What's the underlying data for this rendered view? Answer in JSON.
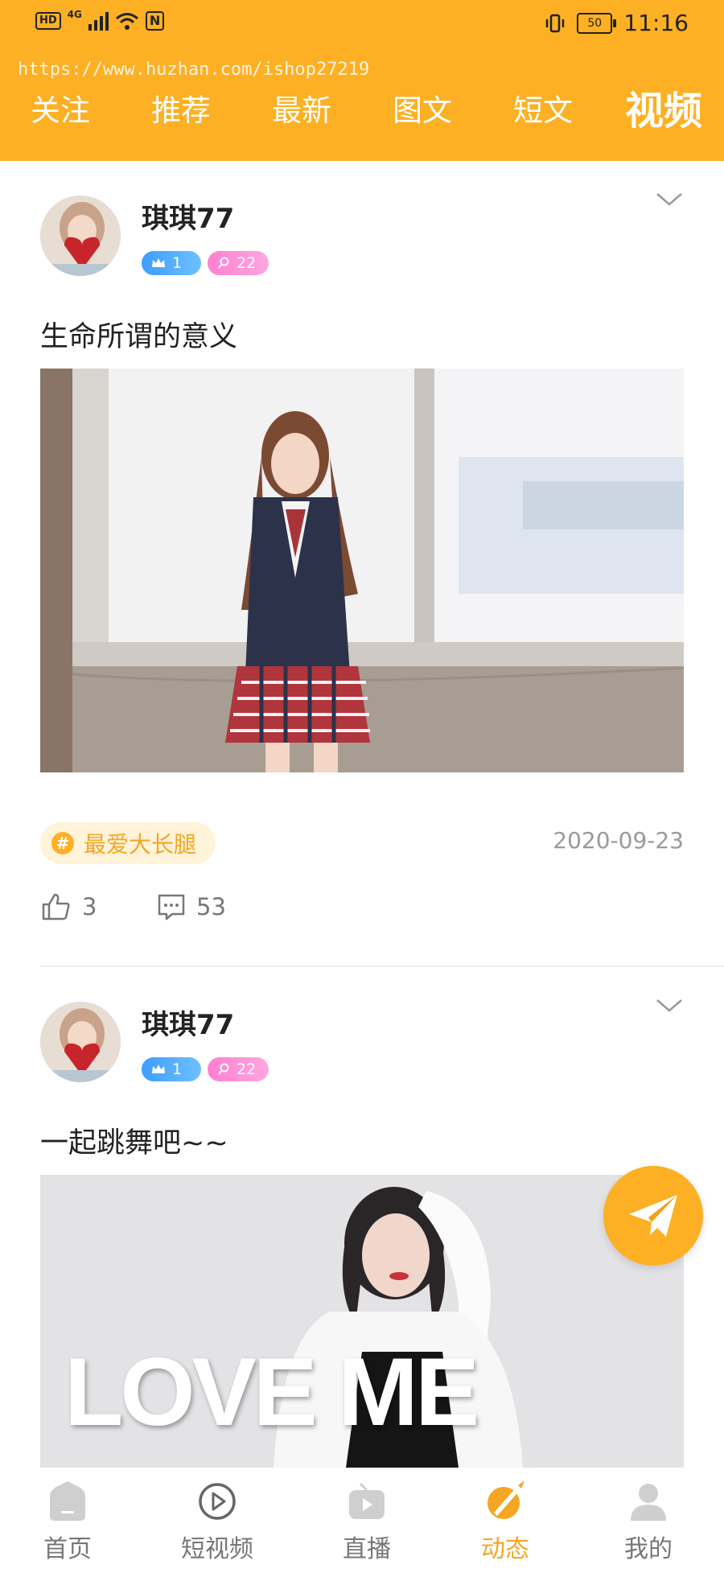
{
  "status_bar": {
    "hd": "HD",
    "network": "4G",
    "nfc": "N",
    "battery": "50",
    "time": "11:16"
  },
  "watermark": "https://www.huzhan.com/ishop27219",
  "tabs": [
    "关注",
    "推荐",
    "最新",
    "图文",
    "短文",
    "视频"
  ],
  "active_tab": "视频",
  "posts": [
    {
      "username": "琪琪77",
      "level": "1",
      "fans": "22",
      "caption": "生命所谓的意义",
      "topic": "最爱大长腿",
      "topic_hash": "#",
      "date": "2020-09-23",
      "likes": "3",
      "comments": "53"
    },
    {
      "username": "琪琪77",
      "level": "1",
      "fans": "22",
      "caption": "一起跳舞吧~~",
      "image_text": "LOVE ME"
    }
  ],
  "bottom_nav": {
    "items": [
      "首页",
      "短视频",
      "直播",
      "动态",
      "我的"
    ],
    "active": "动态"
  },
  "colors": {
    "brand": "#FDB023",
    "active_text": "#F5A623",
    "level_badge": "#3d9dff",
    "fans_badge": "#ff7fd1"
  },
  "icons": {
    "status_signal": "signal-icon",
    "status_wifi": "wifi-icon",
    "status_vibrate": "vibrate-icon",
    "more": "chevron-down-icon",
    "like": "thumb-up-icon",
    "comment": "comment-icon",
    "fab": "paper-plane-icon",
    "nav": [
      "home-icon",
      "play-circle-icon",
      "live-tv-icon",
      "moments-icon",
      "profile-icon"
    ]
  }
}
